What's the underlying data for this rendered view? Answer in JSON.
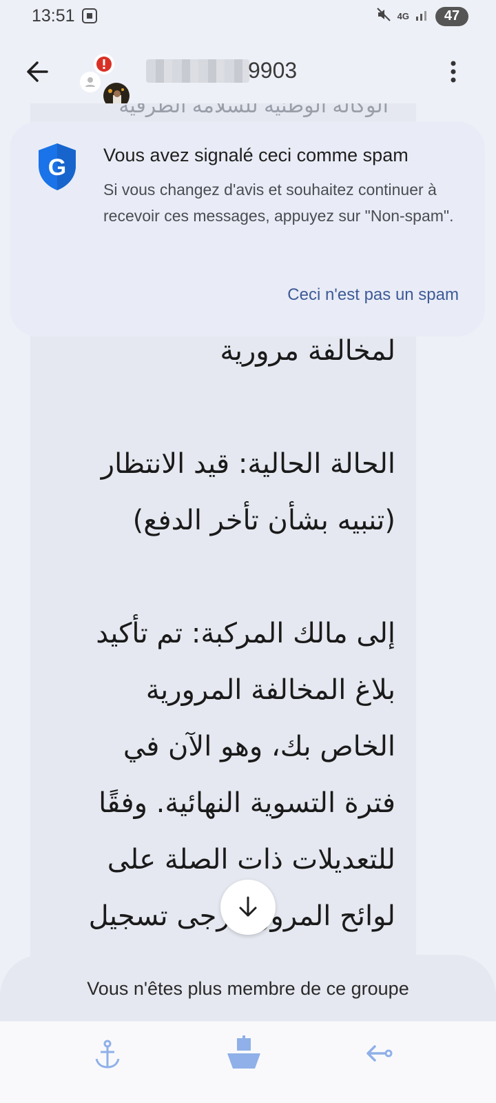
{
  "status_bar": {
    "time": "13:51",
    "network": "4G",
    "battery": "47"
  },
  "app_bar": {
    "contact_suffix": "9903",
    "icons": [
      "back-arrow-icon",
      "alert-badge-icon",
      "person-icon",
      "more-vert-icon"
    ]
  },
  "spam_card": {
    "title": "Vous avez signalé ceci comme spam",
    "body": "Si vous changez d'avis et souhaitez continuer à recevoir ces messages, appuyez sur \"Non-spam\".",
    "button": "Ceci n'est pas un spam",
    "icon_letter": "G"
  },
  "message": {
    "partial_top": "الوكالة الوطنية للسلامة الطرقية",
    "text": "لمخالفة مرورية\n\nالحالة الحالية: قيد الانتظار\n(تنبيه بشأن تأخر الدفع)\n\nإلى مالك المركبة: تم تأكيد\nبلاغ المخالفة المرورية\nالخاص بك، وهو الآن في\nفترة التسوية النهائية. وفقًا\nللتعديلات ذات الصلة على\nلوائح المرور، يرجى تسجيل"
  },
  "notice": "Vous n'êtes plus membre de ce groupe",
  "colors": {
    "background": "#eef0f8",
    "bubble": "#e5e8f0",
    "shield": "#1a73e8",
    "link": "#3d5a96",
    "nav_icons": "#8fb0e8"
  }
}
